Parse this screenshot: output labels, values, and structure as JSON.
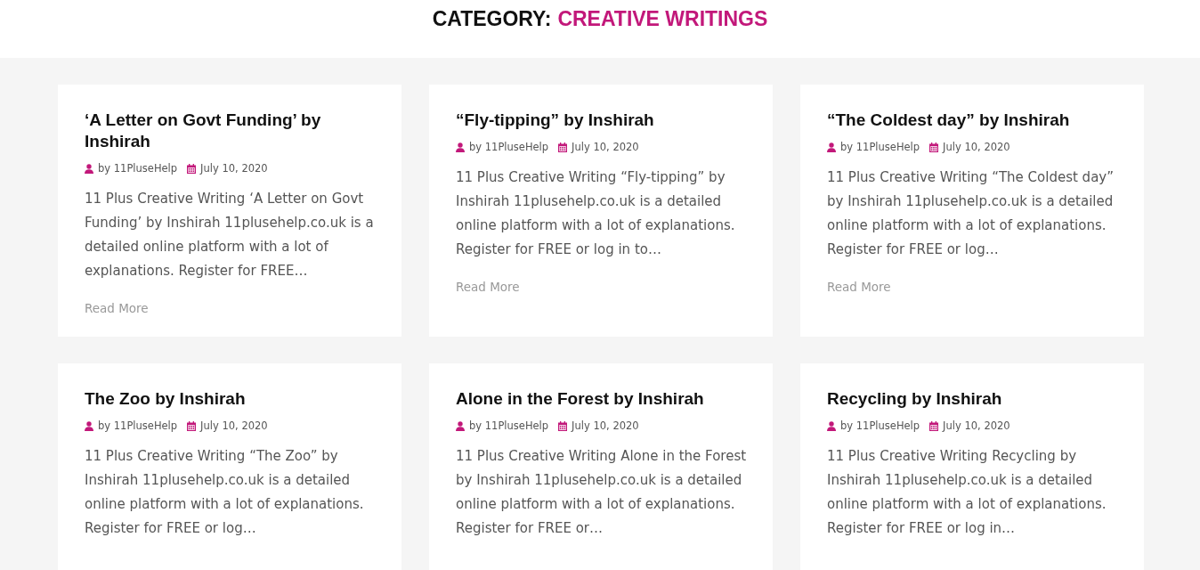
{
  "heading": {
    "label": "CATEGORY:",
    "value": "CREATIVE WRITINGS"
  },
  "posts": [
    {
      "title": "‘A Letter on Govt Funding’ by Inshirah",
      "author": "by 11PluseHelp",
      "date": "July 10, 2020",
      "excerpt": "11 Plus Creative Writing ‘A Letter on Govt Funding’ by Inshirah 11plusehelp.co.uk is a detailed online platform with a lot of explanations. Register for FREE…",
      "read_more": "Read More"
    },
    {
      "title": "“Fly-tipping” by Inshirah",
      "author": "by 11PluseHelp",
      "date": "July 10, 2020",
      "excerpt": "11 Plus Creative Writing “Fly-tipping” by Inshirah 11plusehelp.co.uk is a detailed online platform with a lot of explanations. Register for FREE or log in to…",
      "read_more": "Read More"
    },
    {
      "title": "“The Coldest day” by Inshirah",
      "author": "by 11PluseHelp",
      "date": "July 10, 2020",
      "excerpt": "11 Plus Creative Writing “The Coldest day” by Inshirah 11plusehelp.co.uk is a detailed online platform with a lot of explanations. Register for FREE or log…",
      "read_more": "Read More"
    },
    {
      "title": "The Zoo by Inshirah",
      "author": "by 11PluseHelp",
      "date": "July 10, 2020",
      "excerpt": "11 Plus Creative Writing “The Zoo” by Inshirah 11plusehelp.co.uk is a detailed online platform with a lot of explanations. Register for FREE or log…"
    },
    {
      "title": "Alone in the Forest by Inshirah",
      "author": "by 11PluseHelp",
      "date": "July 10, 2020",
      "excerpt": "11 Plus Creative Writing Alone in the Forest by Inshirah 11plusehelp.co.uk is a detailed online platform with a lot of explanations. Register for FREE or…"
    },
    {
      "title": "Recycling by Inshirah",
      "author": "by 11PluseHelp",
      "date": "July 10, 2020",
      "excerpt": "11 Plus Creative Writing Recycling by Inshirah 11plusehelp.co.uk is a detailed online platform with a lot of explanations. Register for FREE or log in…"
    }
  ]
}
